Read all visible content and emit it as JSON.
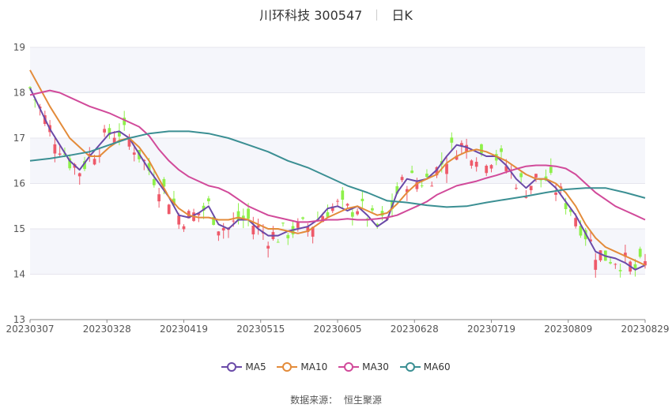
{
  "header": {
    "stock_name": "川环科技 300547",
    "period": "日K"
  },
  "source": {
    "label": "数据来源：",
    "provider": "恒生聚源"
  },
  "colors": {
    "up": "#ee5a6a",
    "down": "#8ef04a",
    "grid_band": "#f5f6fb",
    "MA5": "#6a4aa8",
    "MA10": "#e38b3a",
    "MA30": "#d14a9a",
    "MA60": "#3b8f93"
  },
  "chart_data": {
    "type": "candlestick",
    "y_ticks": [
      13,
      14,
      15,
      16,
      17,
      18,
      19
    ],
    "ylim": [
      13,
      19
    ],
    "x_ticks": [
      "20230307",
      "20230328",
      "20230419",
      "20230515",
      "20230605",
      "20230628",
      "20230719",
      "20230809",
      "20230829"
    ],
    "legend": [
      {
        "name": "MA5",
        "color": "#6a4aa8"
      },
      {
        "name": "MA10",
        "color": "#e38b3a"
      },
      {
        "name": "MA30",
        "color": "#d14a9a"
      },
      {
        "name": "MA60",
        "color": "#3b8f93"
      }
    ],
    "series": [
      {
        "name": "MA5",
        "points": [
          [
            0,
            18.1
          ],
          [
            4,
            17.2
          ],
          [
            8,
            16.5
          ],
          [
            10,
            16.3
          ],
          [
            12,
            16.6
          ],
          [
            16,
            17.1
          ],
          [
            18,
            17.15
          ],
          [
            20,
            17.0
          ],
          [
            24,
            16.3
          ],
          [
            28,
            15.7
          ],
          [
            30,
            15.3
          ],
          [
            32,
            15.25
          ],
          [
            34,
            15.35
          ],
          [
            36,
            15.5
          ],
          [
            38,
            15.1
          ],
          [
            40,
            15.0
          ],
          [
            42,
            15.2
          ],
          [
            44,
            15.2
          ],
          [
            46,
            15.0
          ],
          [
            48,
            14.85
          ],
          [
            50,
            14.85
          ],
          [
            52,
            14.95
          ],
          [
            54,
            15.0
          ],
          [
            56,
            15.05
          ],
          [
            58,
            15.2
          ],
          [
            60,
            15.45
          ],
          [
            62,
            15.5
          ],
          [
            64,
            15.4
          ],
          [
            66,
            15.5
          ],
          [
            68,
            15.3
          ],
          [
            70,
            15.05
          ],
          [
            72,
            15.2
          ],
          [
            74,
            15.8
          ],
          [
            76,
            16.1
          ],
          [
            78,
            16.05
          ],
          [
            80,
            16.1
          ],
          [
            82,
            16.3
          ],
          [
            84,
            16.6
          ],
          [
            86,
            16.85
          ],
          [
            88,
            16.8
          ],
          [
            90,
            16.7
          ],
          [
            92,
            16.6
          ],
          [
            94,
            16.6
          ],
          [
            96,
            16.4
          ],
          [
            98,
            16.1
          ],
          [
            100,
            15.9
          ],
          [
            102,
            16.1
          ],
          [
            104,
            16.1
          ],
          [
            106,
            15.9
          ],
          [
            108,
            15.6
          ],
          [
            110,
            15.3
          ],
          [
            112,
            14.9
          ],
          [
            114,
            14.5
          ],
          [
            116,
            14.4
          ],
          [
            118,
            14.35
          ],
          [
            120,
            14.25
          ],
          [
            122,
            14.1
          ],
          [
            124,
            14.2
          ]
        ]
      },
      {
        "name": "MA10",
        "points": [
          [
            0,
            18.5
          ],
          [
            4,
            17.7
          ],
          [
            8,
            17.0
          ],
          [
            10,
            16.8
          ],
          [
            12,
            16.6
          ],
          [
            14,
            16.6
          ],
          [
            16,
            16.8
          ],
          [
            18,
            16.95
          ],
          [
            20,
            17.0
          ],
          [
            22,
            16.8
          ],
          [
            24,
            16.5
          ],
          [
            26,
            16.1
          ],
          [
            28,
            15.7
          ],
          [
            30,
            15.45
          ],
          [
            32,
            15.3
          ],
          [
            34,
            15.25
          ],
          [
            36,
            15.25
          ],
          [
            38,
            15.2
          ],
          [
            40,
            15.2
          ],
          [
            42,
            15.25
          ],
          [
            44,
            15.2
          ],
          [
            46,
            15.1
          ],
          [
            48,
            15.0
          ],
          [
            50,
            15.0
          ],
          [
            52,
            14.95
          ],
          [
            54,
            14.9
          ],
          [
            56,
            14.95
          ],
          [
            58,
            15.1
          ],
          [
            60,
            15.25
          ],
          [
            62,
            15.35
          ],
          [
            64,
            15.45
          ],
          [
            66,
            15.5
          ],
          [
            68,
            15.4
          ],
          [
            70,
            15.3
          ],
          [
            72,
            15.35
          ],
          [
            74,
            15.55
          ],
          [
            76,
            15.8
          ],
          [
            78,
            16.0
          ],
          [
            80,
            16.1
          ],
          [
            82,
            16.2
          ],
          [
            84,
            16.45
          ],
          [
            86,
            16.6
          ],
          [
            88,
            16.7
          ],
          [
            90,
            16.75
          ],
          [
            92,
            16.7
          ],
          [
            94,
            16.6
          ],
          [
            96,
            16.5
          ],
          [
            98,
            16.35
          ],
          [
            100,
            16.2
          ],
          [
            102,
            16.1
          ],
          [
            104,
            16.1
          ],
          [
            106,
            16.0
          ],
          [
            108,
            15.8
          ],
          [
            110,
            15.5
          ],
          [
            112,
            15.1
          ],
          [
            114,
            14.8
          ],
          [
            116,
            14.6
          ],
          [
            118,
            14.5
          ],
          [
            120,
            14.4
          ],
          [
            122,
            14.3
          ],
          [
            124,
            14.2
          ]
        ]
      },
      {
        "name": "MA30",
        "points": [
          [
            0,
            17.95
          ],
          [
            4,
            18.05
          ],
          [
            6,
            18.0
          ],
          [
            8,
            17.9
          ],
          [
            12,
            17.7
          ],
          [
            16,
            17.55
          ],
          [
            18,
            17.45
          ],
          [
            20,
            17.35
          ],
          [
            22,
            17.25
          ],
          [
            24,
            17.05
          ],
          [
            26,
            16.75
          ],
          [
            28,
            16.5
          ],
          [
            30,
            16.3
          ],
          [
            32,
            16.15
          ],
          [
            34,
            16.05
          ],
          [
            36,
            15.95
          ],
          [
            38,
            15.9
          ],
          [
            40,
            15.8
          ],
          [
            42,
            15.65
          ],
          [
            44,
            15.5
          ],
          [
            46,
            15.4
          ],
          [
            48,
            15.3
          ],
          [
            50,
            15.25
          ],
          [
            52,
            15.2
          ],
          [
            54,
            15.15
          ],
          [
            56,
            15.15
          ],
          [
            58,
            15.18
          ],
          [
            60,
            15.2
          ],
          [
            62,
            15.2
          ],
          [
            64,
            15.22
          ],
          [
            66,
            15.2
          ],
          [
            68,
            15.2
          ],
          [
            70,
            15.22
          ],
          [
            72,
            15.25
          ],
          [
            74,
            15.3
          ],
          [
            76,
            15.4
          ],
          [
            78,
            15.5
          ],
          [
            80,
            15.6
          ],
          [
            82,
            15.75
          ],
          [
            84,
            15.85
          ],
          [
            86,
            15.95
          ],
          [
            88,
            16.0
          ],
          [
            90,
            16.05
          ],
          [
            92,
            16.12
          ],
          [
            94,
            16.18
          ],
          [
            96,
            16.25
          ],
          [
            98,
            16.32
          ],
          [
            100,
            16.38
          ],
          [
            102,
            16.4
          ],
          [
            104,
            16.4
          ],
          [
            106,
            16.38
          ],
          [
            108,
            16.33
          ],
          [
            110,
            16.2
          ],
          [
            112,
            16.0
          ],
          [
            114,
            15.8
          ],
          [
            116,
            15.65
          ],
          [
            118,
            15.5
          ],
          [
            120,
            15.4
          ],
          [
            122,
            15.3
          ],
          [
            124,
            15.2
          ]
        ]
      },
      {
        "name": "MA60",
        "points": [
          [
            0,
            16.5
          ],
          [
            4,
            16.55
          ],
          [
            8,
            16.62
          ],
          [
            12,
            16.7
          ],
          [
            16,
            16.85
          ],
          [
            20,
            17.0
          ],
          [
            24,
            17.1
          ],
          [
            28,
            17.15
          ],
          [
            32,
            17.15
          ],
          [
            36,
            17.1
          ],
          [
            40,
            17.0
          ],
          [
            44,
            16.85
          ],
          [
            48,
            16.7
          ],
          [
            52,
            16.5
          ],
          [
            56,
            16.35
          ],
          [
            60,
            16.15
          ],
          [
            64,
            15.95
          ],
          [
            68,
            15.8
          ],
          [
            72,
            15.62
          ],
          [
            76,
            15.58
          ],
          [
            80,
            15.52
          ],
          [
            84,
            15.48
          ],
          [
            88,
            15.5
          ],
          [
            92,
            15.58
          ],
          [
            96,
            15.65
          ],
          [
            100,
            15.72
          ],
          [
            104,
            15.8
          ],
          [
            108,
            15.87
          ],
          [
            112,
            15.9
          ],
          [
            116,
            15.9
          ],
          [
            120,
            15.8
          ],
          [
            124,
            15.68
          ]
        ]
      }
    ]
  }
}
